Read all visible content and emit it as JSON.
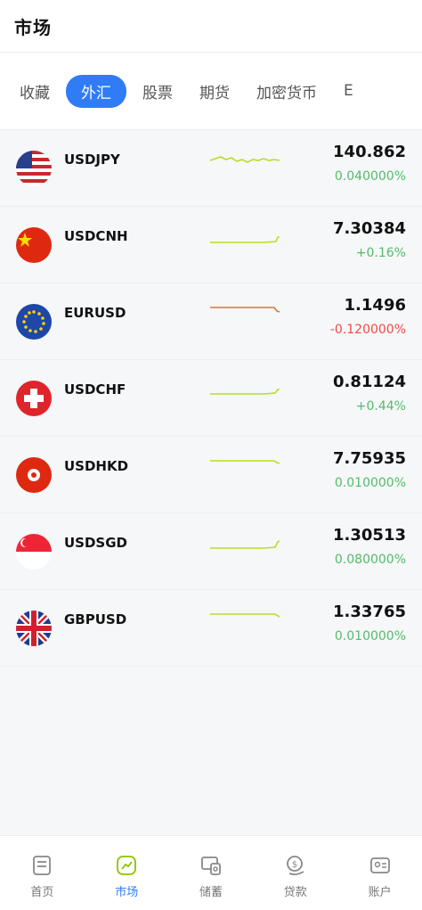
{
  "header": {
    "title": "市场"
  },
  "tabs": [
    {
      "label": "收藏",
      "active": false
    },
    {
      "label": "外汇",
      "active": true
    },
    {
      "label": "股票",
      "active": false
    },
    {
      "label": "期货",
      "active": false
    },
    {
      "label": "加密货币",
      "active": false
    },
    {
      "label": "E",
      "active": false
    }
  ],
  "pairs": [
    {
      "symbol": "USDJPY",
      "price": "140.862",
      "change": "0.040000%",
      "direction": "up",
      "flag": "us-flag"
    },
    {
      "symbol": "USDCNH",
      "price": "7.30384",
      "change": "+0.16%",
      "direction": "up",
      "flag": "cn-flag"
    },
    {
      "symbol": "EURUSD",
      "price": "1.1496",
      "change": "-0.120000%",
      "direction": "down",
      "flag": "eu-flag"
    },
    {
      "symbol": "USDCHF",
      "price": "0.81124",
      "change": "+0.44%",
      "direction": "up",
      "flag": "ch-flag"
    },
    {
      "symbol": "USDHKD",
      "price": "7.75935",
      "change": "0.010000%",
      "direction": "up",
      "flag": "hk-flag"
    },
    {
      "symbol": "USDSGD",
      "price": "1.30513",
      "change": "0.080000%",
      "direction": "up",
      "flag": "sg-flag"
    },
    {
      "symbol": "GBPUSD",
      "price": "1.33765",
      "change": "0.010000%",
      "direction": "up",
      "flag": "gb-flag"
    }
  ],
  "colors": {
    "accent": "#2f7cf6",
    "up": "#52bb6a",
    "down": "#f04848",
    "spark_up": "#b5dd2a",
    "spark_down": "#d9773b"
  },
  "nav": [
    {
      "label": "首页",
      "icon": "home-icon",
      "active": false
    },
    {
      "label": "市场",
      "icon": "market-icon",
      "active": true
    },
    {
      "label": "储蓄",
      "icon": "savings-icon",
      "active": false
    },
    {
      "label": "贷款",
      "icon": "loan-icon",
      "active": false
    },
    {
      "label": "账户",
      "icon": "account-icon",
      "active": false
    }
  ]
}
